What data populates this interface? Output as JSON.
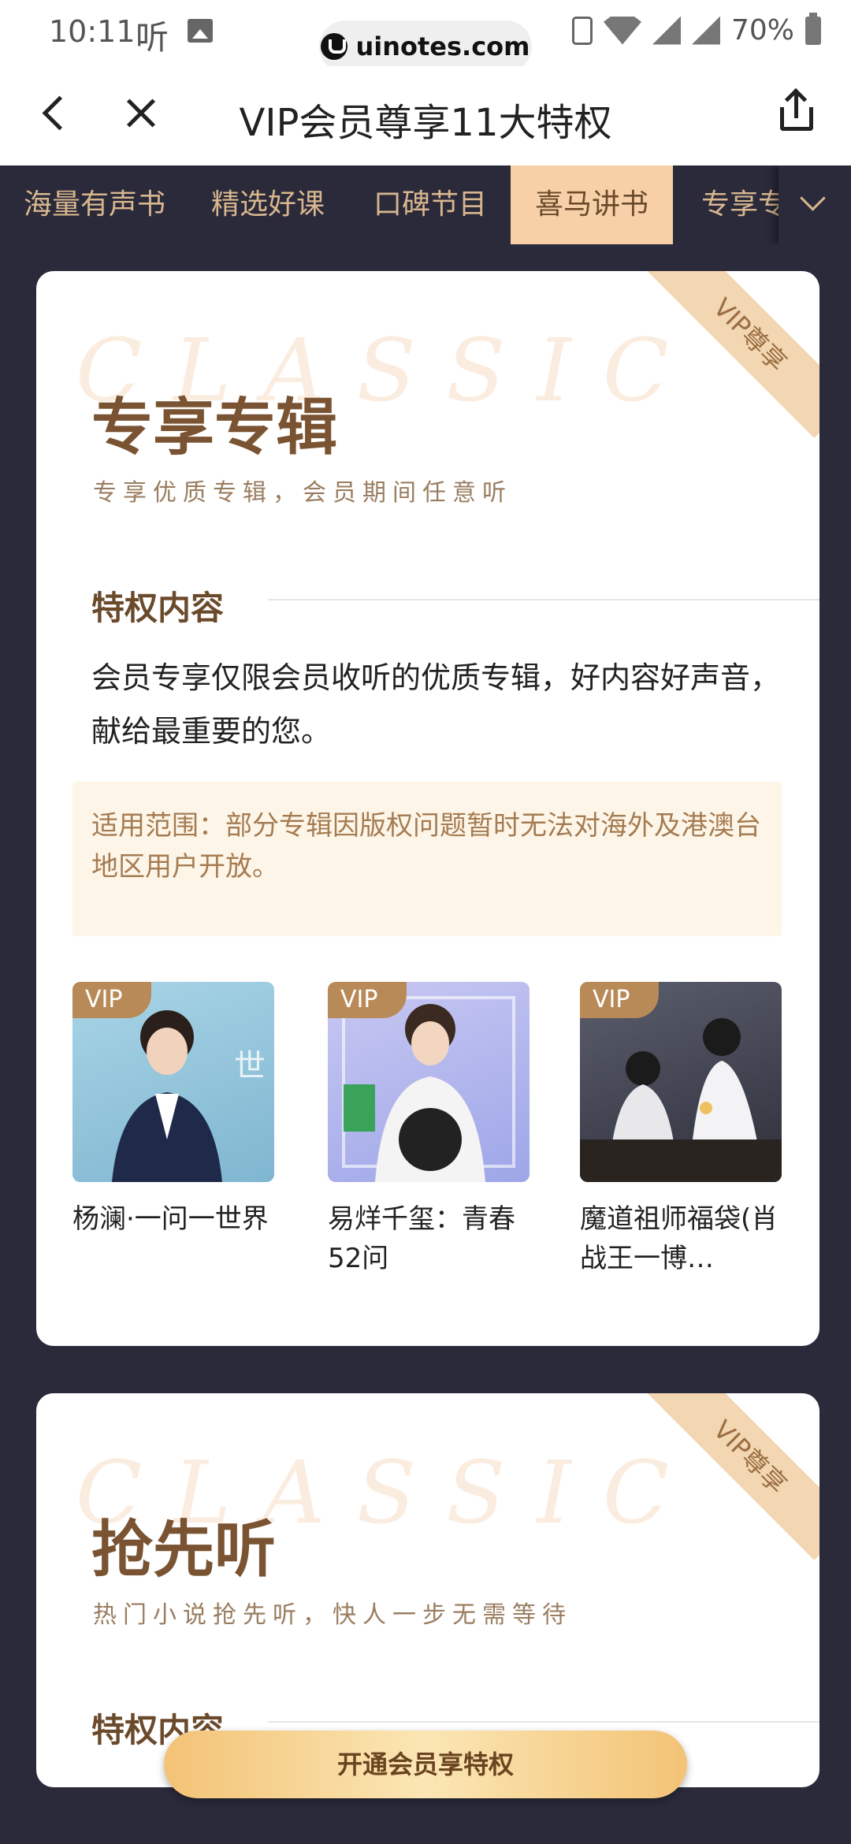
{
  "status_bar": {
    "time": "10:11",
    "ting_icon": "听",
    "url": "uinotes.com",
    "battery": "70%"
  },
  "header": {
    "title": "VIP会员尊享11大特权"
  },
  "tabs": [
    {
      "label": "海量有声书",
      "active": false
    },
    {
      "label": "精选好课",
      "active": false
    },
    {
      "label": "口碑节目",
      "active": false
    },
    {
      "label": "喜马讲书",
      "active": true
    },
    {
      "label": "专享专辑",
      "active": false
    }
  ],
  "cards": [
    {
      "ribbon": "VIP尊享",
      "watermark": "CLASSIC",
      "title": "专享专辑",
      "subtitle": "专享优质专辑，会员期间任意听",
      "section_head": "特权内容",
      "description": "会员专享仅限会员收听的优质专辑，好内容好声音，献给最重要的您。",
      "notice": "适用范围：部分专辑因版权问题暂时无法对海外及港澳台地区用户开放。",
      "albums": [
        {
          "badge": "VIP",
          "title": "杨澜·一问一世界"
        },
        {
          "badge": "VIP",
          "title": "易烊千玺：青春52问"
        },
        {
          "badge": "VIP",
          "title": "魔道祖师福袋(肖战王一博…"
        }
      ]
    },
    {
      "ribbon": "VIP尊享",
      "watermark": "CLASSIC",
      "title": "抢先听",
      "subtitle": "热门小说抢先听，快人一步无需等待",
      "section_head": "特权内容"
    }
  ],
  "cta_label": "开通会员享特权",
  "colors": {
    "background": "#2b2a3a",
    "tab_active_bg": "#f7d0a7",
    "tab_text": "#d8b78f",
    "title_brown": "#7a5432",
    "cta_gold": "#f3c376"
  }
}
